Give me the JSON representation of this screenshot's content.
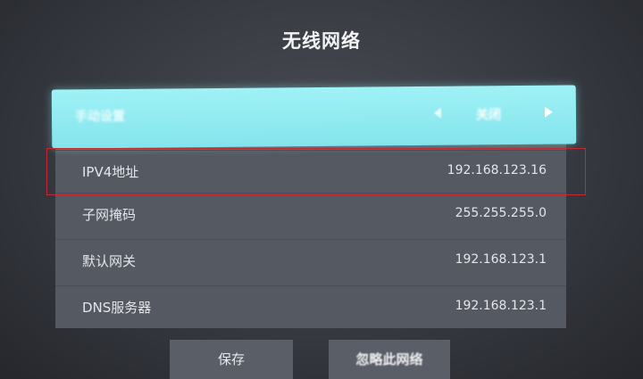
{
  "title": "无线网络",
  "selected_row": {
    "label": "手动设置",
    "value": "关闭"
  },
  "rows": [
    {
      "label": "IPV4地址",
      "value": "192.168.123.16"
    },
    {
      "label": "子网掩码",
      "value": "255.255.255.0"
    },
    {
      "label": "默认网关",
      "value": "192.168.123.1"
    },
    {
      "label": "DNS服务器",
      "value": "192.168.123.1"
    }
  ],
  "buttons": {
    "save": "保存",
    "forget": "忽略此网络"
  },
  "colors": {
    "selection": "#8fe9f0",
    "highlight_box": "#c02a32",
    "panel": "#555961"
  },
  "icons": {
    "left": "chevron-left-icon",
    "right": "chevron-right-icon"
  }
}
